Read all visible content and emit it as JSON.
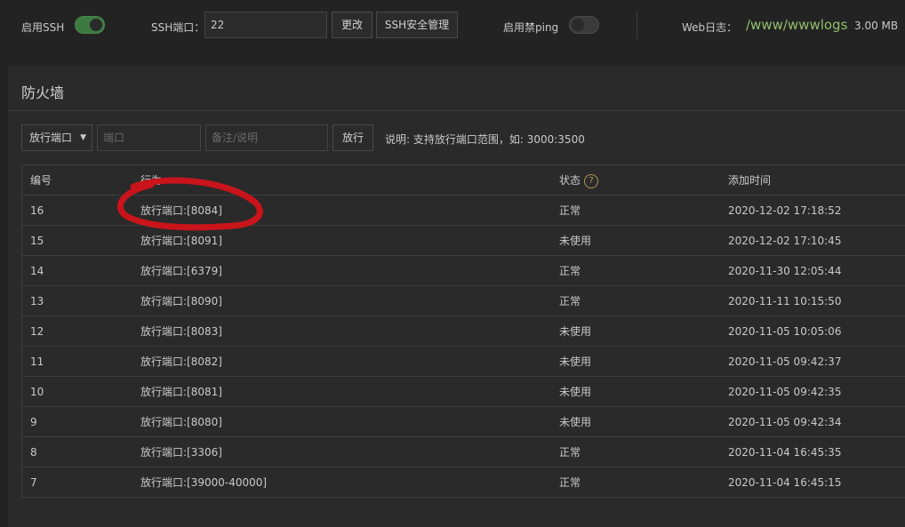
{
  "topbar": {
    "ssh_label": "启用SSH",
    "ssh_enabled": true,
    "ssh_port_label": "SSH端口：",
    "ssh_port_value": "22",
    "change_button": "更改",
    "ssh_security_button": "SSH安全管理",
    "noping_label": "启用禁ping",
    "noping_enabled": false,
    "weblog_label": "Web日志：",
    "weblog_path": "/www/wwwlogs",
    "weblog_size": "3.00 MB"
  },
  "firewall": {
    "title": "防火墙",
    "mode_select": "放行端口",
    "port_placeholder": "端口",
    "note_placeholder": "备注/说明",
    "allow_button": "放行",
    "hint": "说明: 支持放行端口范围，如: 3000:3500"
  },
  "table": {
    "headers": {
      "id": "编号",
      "action": "行为",
      "status": "状态",
      "time": "添加时间"
    },
    "rows": [
      {
        "id": "16",
        "action": "放行端口:[8084]",
        "status": "正常",
        "time": "2020-12-02 17:18:52"
      },
      {
        "id": "15",
        "action": "放行端口:[8091]",
        "status": "未使用",
        "time": "2020-12-02 17:10:45"
      },
      {
        "id": "14",
        "action": "放行端口:[6379]",
        "status": "正常",
        "time": "2020-11-30 12:05:44"
      },
      {
        "id": "13",
        "action": "放行端口:[8090]",
        "status": "正常",
        "time": "2020-11-11 10:15:50"
      },
      {
        "id": "12",
        "action": "放行端口:[8083]",
        "status": "未使用",
        "time": "2020-11-05 10:05:06"
      },
      {
        "id": "11",
        "action": "放行端口:[8082]",
        "status": "未使用",
        "time": "2020-11-05 09:42:37"
      },
      {
        "id": "10",
        "action": "放行端口:[8081]",
        "status": "未使用",
        "time": "2020-11-05 09:42:35"
      },
      {
        "id": "9",
        "action": "放行端口:[8080]",
        "status": "未使用",
        "time": "2020-11-05 09:42:34"
      },
      {
        "id": "8",
        "action": "放行端口:[3306]",
        "status": "正常",
        "time": "2020-11-04 16:45:35"
      },
      {
        "id": "7",
        "action": "放行端口:[39000-40000]",
        "status": "正常",
        "time": "2020-11-04 16:45:15"
      }
    ]
  },
  "colors": {
    "toggle_on": "#3d7a42",
    "path_green": "#8fbf6c",
    "annotation_red": "#c8141a"
  },
  "icons": {
    "status_help": "question-circle-icon",
    "select_caret": "caret-down-icon"
  }
}
